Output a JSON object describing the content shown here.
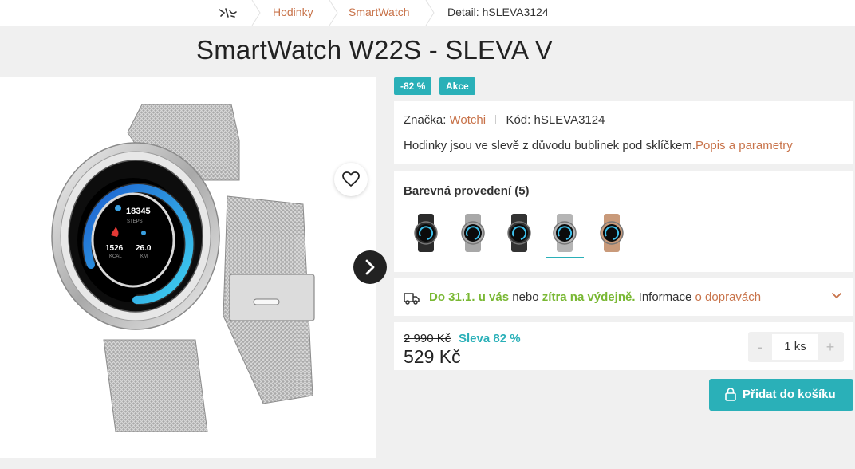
{
  "breadcrumb": {
    "items": [
      "Hodinky",
      "SmartWatch"
    ],
    "current": "Detail: hSLEVA3124"
  },
  "product": {
    "title": "SmartWatch W22S - SLEVA V",
    "badges": [
      "-82 %",
      "Akce"
    ],
    "brand_label": "Značka:",
    "brand": "Wotchi",
    "code_label": "Kód: hSLEVA3124",
    "description": "Hodinky jsou ve slevě z důvodu bublinek pod sklíčkem.",
    "description_link": "Popis a parametry",
    "watch_face": {
      "steps": "18345",
      "steps_label": "STEPS",
      "kcal": "1526",
      "kcal_label": "KCAL",
      "km": "26.0",
      "km_label": "KM"
    }
  },
  "variants": {
    "heading": "Barevná provedení (5)",
    "items": [
      {
        "name": "black",
        "color": "#2b2b2b"
      },
      {
        "name": "silver",
        "color": "#a8a8a8"
      },
      {
        "name": "black-silver",
        "color": "#333333"
      },
      {
        "name": "silver-mesh",
        "color": "#b5b5b5",
        "selected": true
      },
      {
        "name": "rose-gold",
        "color": "#c99a7a"
      }
    ]
  },
  "delivery": {
    "part1": "Do 31.1. u vás",
    "part2": " nebo ",
    "part3": "zítra na výdejně.",
    "part4": " Informace ",
    "link": "o dopravách"
  },
  "pricing": {
    "old_price": "2 990 Kč",
    "discount": "Sleva 82 %",
    "price": "529 Kč",
    "quantity": "1 ks",
    "minus": "-",
    "plus": "+"
  },
  "cart_button": {
    "label": "Přidat do košíku"
  },
  "colors": {
    "accent": "#2ab0b8",
    "link": "#c8734a",
    "green": "#79b833"
  }
}
